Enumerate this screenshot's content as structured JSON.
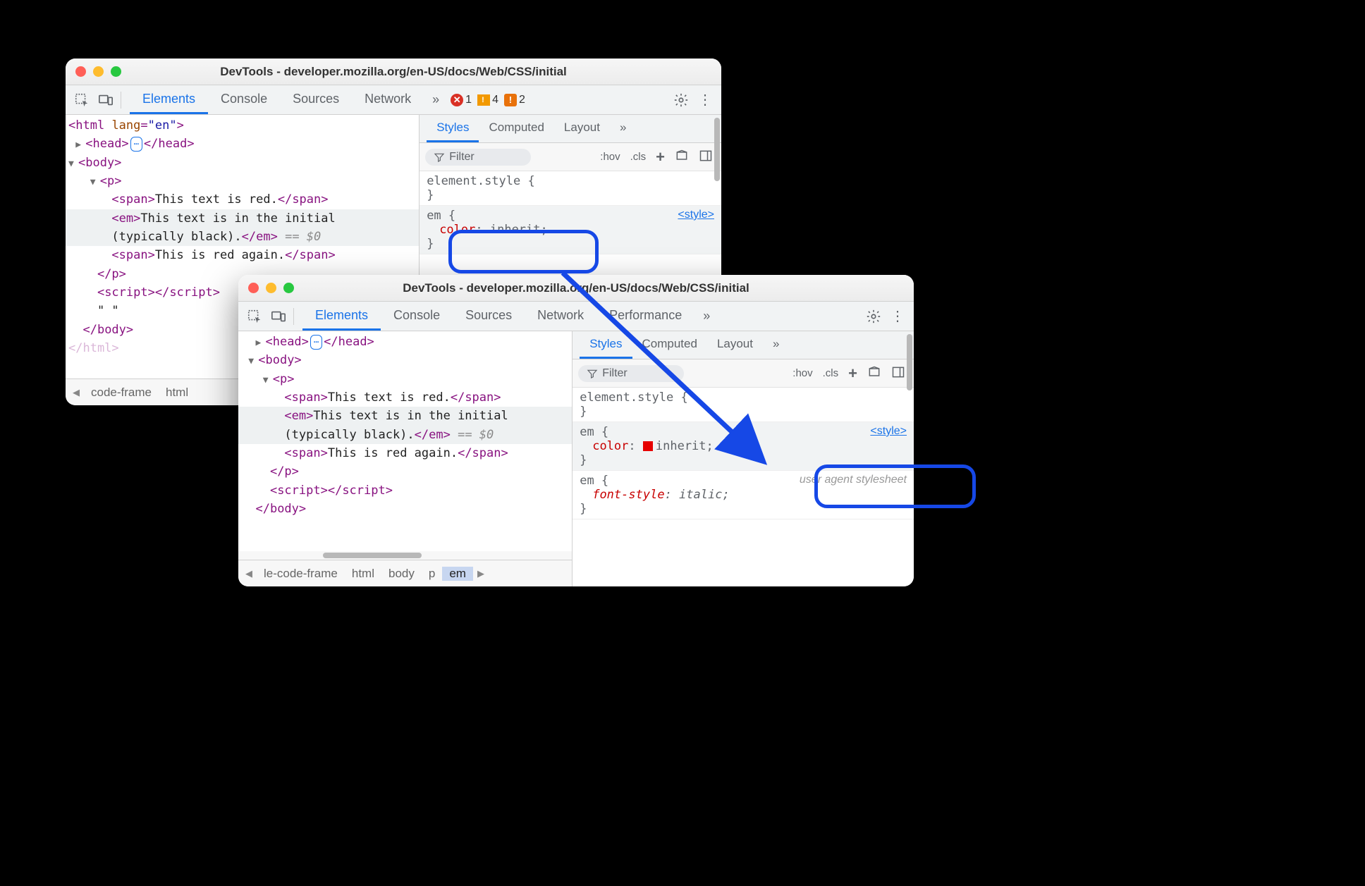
{
  "window1": {
    "title": "DevTools - developer.mozilla.org/en-US/docs/Web/CSS/initial",
    "tabs": [
      "Elements",
      "Console",
      "Sources",
      "Network"
    ],
    "active_tab": 0,
    "badges": {
      "errors": "1",
      "warnings": "4",
      "issues": "2"
    },
    "subtabs": [
      "Styles",
      "Computed",
      "Layout"
    ],
    "active_subtab": 0,
    "filter_placeholder": "Filter",
    "hov": ":hov",
    "cls": ".cls",
    "rules": {
      "elstyle": "element.style {",
      "em_sel": "em {",
      "style_src": "<style>",
      "color_prop": "color",
      "color_val": "inherit",
      "close": "}"
    },
    "dom": {
      "html_open": "<html lang=\"en\">",
      "head": {
        "open": "<head>",
        "close": "</head>",
        "ell": "⋯"
      },
      "body_open": "<body>",
      "p_open": "<p>",
      "span1": {
        "open": "<span>",
        "text": "This text is red.",
        "close": "</span>"
      },
      "em": {
        "open": "<em>",
        "text1": "This text is in the initial",
        "text2": "(typically black).",
        "close": "</em>",
        "eq": " == $0"
      },
      "span2": {
        "open": "<span>",
        "text": "This is red again.",
        "close": "</span>"
      },
      "p_close": "</p>",
      "script": {
        "open": "<script>",
        "close": "</scr"
      },
      "quote": "\" \"",
      "body_close": "</body>",
      "html_close": "</html>"
    },
    "breadcrumb": [
      "code-frame",
      "html"
    ]
  },
  "window2": {
    "title": "DevTools - developer.mozilla.org/en-US/docs/Web/CSS/initial",
    "tabs": [
      "Elements",
      "Console",
      "Sources",
      "Network",
      "Performance"
    ],
    "active_tab": 0,
    "subtabs": [
      "Styles",
      "Computed",
      "Layout"
    ],
    "active_subtab": 0,
    "filter_placeholder": "Filter",
    "hov": ":hov",
    "cls": ".cls",
    "rules": {
      "elstyle": "element.style {",
      "em_sel": "em {",
      "style_src": "<style>",
      "color_prop": "color",
      "color_val": "inherit",
      "close": "}",
      "ua_em_sel": "em {",
      "ua_src": "user agent stylesheet",
      "fs_prop": "font-style",
      "fs_val": "italic"
    },
    "dom": {
      "head": {
        "open": "<head>",
        "close": "</head>",
        "ell": "⋯"
      },
      "body_open": "<body>",
      "p_open": "<p>",
      "span1": {
        "open": "<span>",
        "text": "This text is red.",
        "close": "</span>"
      },
      "em": {
        "open": "<em>",
        "text1": "This text is in the initial",
        "text2": "(typically black).",
        "close": "</em>",
        "eq": " == $0"
      },
      "span2": {
        "open": "<span>",
        "text": "This is red again.",
        "close": "</span>"
      },
      "p_close": "</p>",
      "script": {
        "open": "<script>",
        "close": "</scr"
      },
      "body_close": "</body>"
    },
    "breadcrumb": [
      "le-code-frame",
      "html",
      "body",
      "p",
      "em"
    ]
  }
}
